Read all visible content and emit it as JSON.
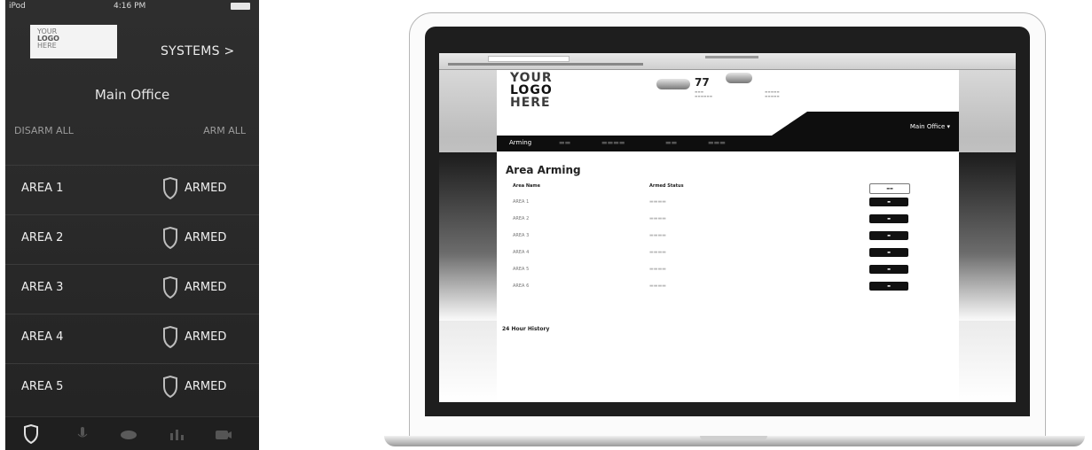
{
  "phone": {
    "carrier": "iPod",
    "time": "4:16 PM",
    "logo": [
      "YOUR",
      "LOGO",
      "HERE"
    ],
    "systems_label": "SYSTEMS >",
    "location": "Main Office",
    "disarm_all": "DISARM ALL",
    "arm_all": "ARM ALL",
    "areas": [
      {
        "name": "AREA 1",
        "status": "ARMED"
      },
      {
        "name": "AREA 2",
        "status": "ARMED"
      },
      {
        "name": "AREA 3",
        "status": "ARMED"
      },
      {
        "name": "AREA 4",
        "status": "ARMED"
      },
      {
        "name": "AREA 5",
        "status": "ARMED"
      }
    ],
    "tabs": [
      "shield-icon",
      "microphone-icon",
      "cloud-icon",
      "bar-chart-icon",
      "camera-icon"
    ]
  },
  "web": {
    "logo": [
      "YOUR",
      "LOGO",
      "HERE"
    ],
    "temperature": "77",
    "location_menu": "Main Office ▾",
    "nav_active": "Arming",
    "page_title": "Area Arming",
    "col_area": "Area Name",
    "col_status": "Armed Status",
    "rows": [
      "AREA 1",
      "AREA 2",
      "AREA 3",
      "AREA 4",
      "AREA 5",
      "AREA 6"
    ],
    "history_title": "24 Hour History"
  },
  "colors": {
    "phone_bg": "#2b2b2b",
    "web_header": "#0e0e0e",
    "accent_button": "#111111"
  }
}
